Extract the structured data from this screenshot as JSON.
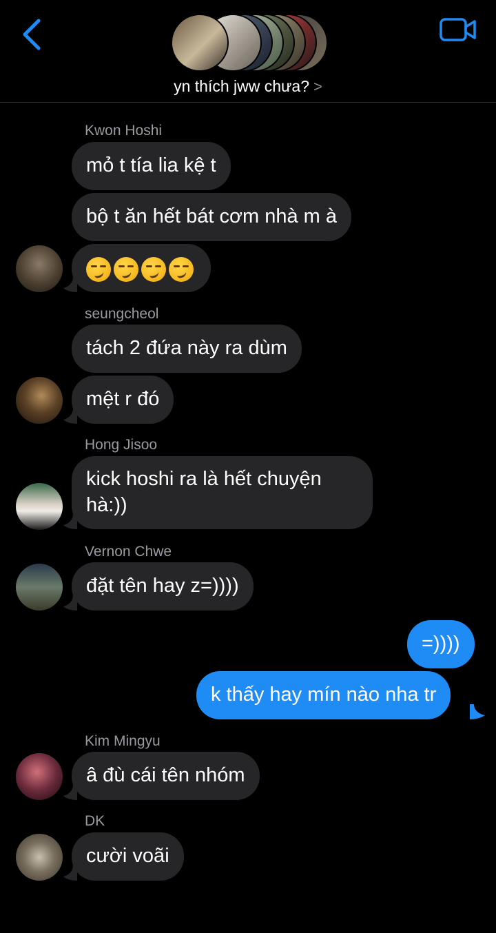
{
  "header": {
    "title": "yn thích jww chưa?",
    "title_chevron": ">",
    "back_icon": "chevron-left-icon",
    "video_icon": "video-camera-icon",
    "accent_color": "#1f8bf5"
  },
  "messages": [
    {
      "sender": "Kwon Hoshi",
      "text": "mỏ t tía lia kệ t"
    },
    {
      "text": "bộ t ăn hết bát cơm nhà m à"
    },
    {
      "text": "😏😏😏😏",
      "emoji_count": 4
    },
    {
      "sender": "seungcheol",
      "text": "tách 2 đứa này ra dùm"
    },
    {
      "text": "mệt r đó"
    },
    {
      "sender": "Hong Jisoo",
      "text": "kick hoshi ra là hết chuyện hà:))"
    },
    {
      "sender": "Vernon Chwe",
      "text": "đặt tên hay z=))))"
    },
    {
      "text": "=))))",
      "outgoing": true
    },
    {
      "text": "k thấy hay mín nào nha tr",
      "outgoing": true
    },
    {
      "sender": "Kim Mingyu",
      "text": "â đù cái tên nhóm"
    },
    {
      "sender": "DK",
      "text": "cười voãi"
    }
  ]
}
